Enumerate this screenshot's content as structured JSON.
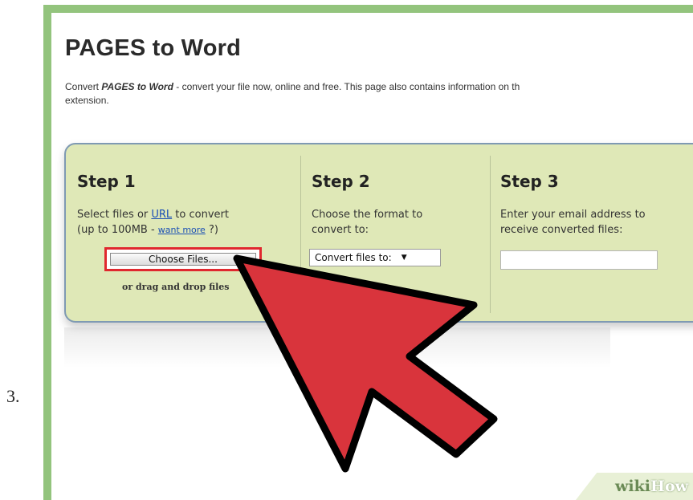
{
  "step_number": "3.",
  "page": {
    "title": "PAGES to Word",
    "intro_bold": "PAGES to Word",
    "intro_prefix": "Convert ",
    "intro_rest": " - convert your file now, online and free. This page also contains information on th",
    "intro_line2": "extension."
  },
  "steps": [
    {
      "title": "Step 1",
      "desc_part1": "Select files or ",
      "url_link": "URL",
      "desc_part2": " to convert",
      "desc_line2_part1": "(up to 100MB - ",
      "want_more_link": "want more",
      "desc_line2_part2": " ?)",
      "choose_button": "Choose Files...",
      "drag_hint": "or drag and drop files"
    },
    {
      "title": "Step 2",
      "desc_line1": "Choose the format to",
      "desc_line2": "convert to:",
      "select_value": "Convert files to:"
    },
    {
      "title": "Step 3",
      "desc_line1": "Enter your email address to",
      "desc_line2": "receive converted files:",
      "email_value": ""
    }
  ],
  "watermark": {
    "wiki": "wiki",
    "how": "How"
  },
  "colors": {
    "frame": "#93c47d",
    "panel": "#dfe8b7",
    "highlight": "#e0282e",
    "arrow": "#d9343c",
    "link": "#1a4fb5"
  },
  "icons": {
    "select_caret": "caret-down-icon",
    "pointer": "arrow-cursor-icon"
  }
}
